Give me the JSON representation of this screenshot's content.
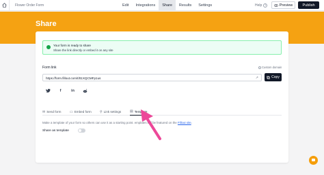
{
  "topbar": {
    "breadcrumb": "Flower Order Form",
    "nav": [
      "Edit",
      "Integrations",
      "Share",
      "Results",
      "Settings"
    ],
    "active_nav": "Share",
    "help": "Help",
    "preview": "Preview",
    "publish": "Publish"
  },
  "page": {
    "title": "Share"
  },
  "alert": {
    "title": "Your form is ready to share",
    "message": "Share the link directly or embed it on any site"
  },
  "form_link": {
    "label": "Form link",
    "custom_domain": "Custom domain",
    "url": "https://form.fillout.com/t/tt1XQCMFp1us",
    "copy": "Copy"
  },
  "socials": [
    "twitter-icon",
    "facebook-icon",
    "linkedin-icon",
    "reddit-icon"
  ],
  "tabs": {
    "send": "Send form",
    "embed": "Embed form",
    "link_settings": "Link settings",
    "template": "Template"
  },
  "template": {
    "description_start": "Make a template of your form so others can use it as a starting point. ",
    "description_end": "emplates will be featured on the ",
    "link": "Fillout site",
    "share_label": "Share as template"
  },
  "colors": {
    "accent": "#f5a212",
    "arrow": "#ec4899",
    "success": "#16a34a"
  }
}
